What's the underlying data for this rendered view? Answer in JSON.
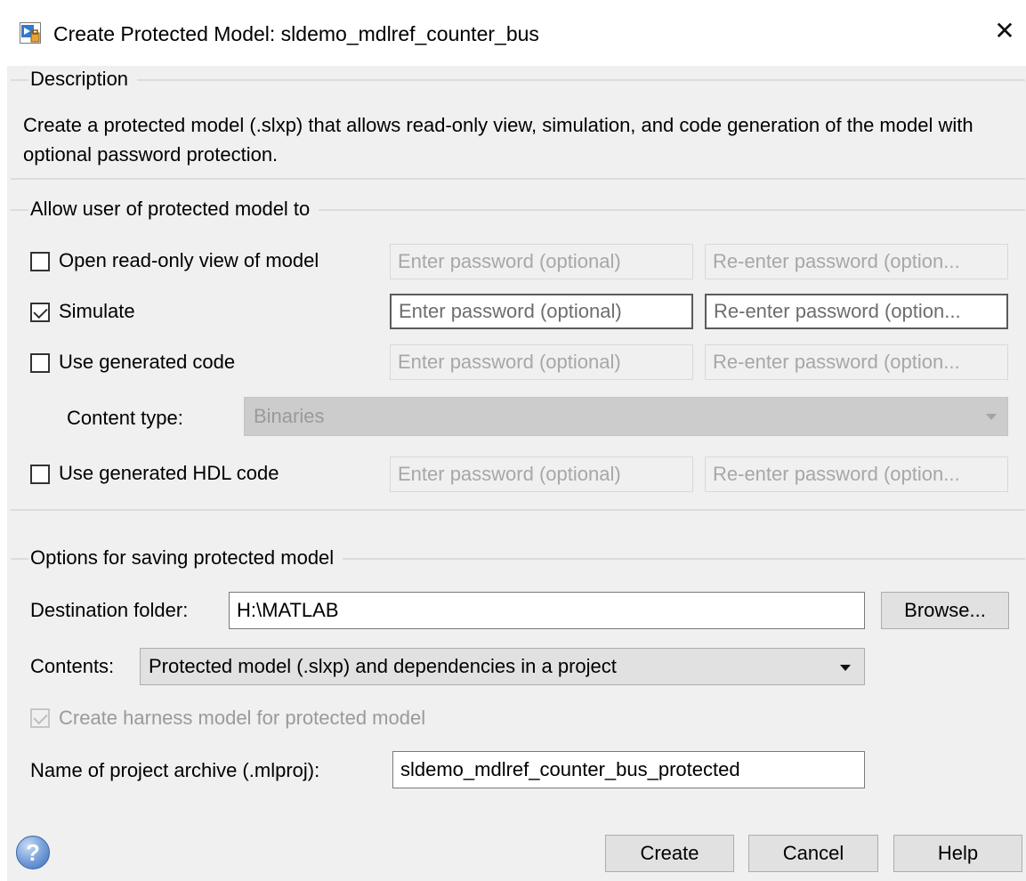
{
  "window": {
    "title": "Create Protected Model: sldemo_mdlref_counter_bus",
    "close_icon": "close-icon",
    "app_icon": "simulink-icon"
  },
  "description": {
    "group_title": "Description",
    "text": "Create a protected model (.slxp) that allows read-only view, simulation, and code generation of the model with optional password protection."
  },
  "permissions": {
    "group_title": "Allow user of protected model to",
    "rows": [
      {
        "label": "Open read-only view of model",
        "checked": false,
        "password_placeholder": "Enter password (optional)",
        "reenter_placeholder": "Re-enter password (option..."
      },
      {
        "label": "Simulate",
        "checked": true,
        "password_placeholder": "Enter password (optional)",
        "reenter_placeholder": "Re-enter password (option..."
      },
      {
        "label": "Use generated code",
        "checked": false,
        "password_placeholder": "Enter password (optional)",
        "reenter_placeholder": "Re-enter password (option..."
      },
      {
        "label": "Use generated HDL code",
        "checked": false,
        "password_placeholder": "Enter password (optional)",
        "reenter_placeholder": "Re-enter password (option..."
      }
    ],
    "content_type": {
      "label": "Content type:",
      "value": "Binaries"
    }
  },
  "saving": {
    "group_title": "Options for saving protected model",
    "destination_label": "Destination folder:",
    "destination_value": "H:\\MATLAB",
    "browse_label": "Browse...",
    "contents_label": "Contents:",
    "contents_value": "Protected model (.slxp) and dependencies in a project",
    "harness_label": "Create harness model for protected model",
    "harness_checked": true,
    "archive_label": "Name of project archive (.mlproj):",
    "archive_value": "sldemo_mdlref_counter_bus_protected"
  },
  "footer": {
    "help_icon": "help-icon",
    "create_label": "Create",
    "cancel_label": "Cancel",
    "help_label": "Help"
  }
}
